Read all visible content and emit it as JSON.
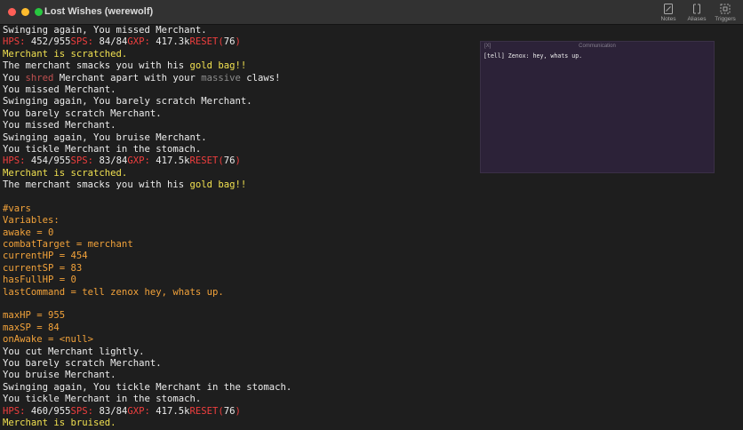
{
  "window": {
    "title": "Lost Wishes (werewolf)",
    "buttons": [
      {
        "label": "Notes",
        "icon": "notes-icon"
      },
      {
        "label": "Aliases",
        "icon": "aliases-icon"
      },
      {
        "label": "Triggers",
        "icon": "triggers-icon"
      }
    ]
  },
  "colors": {
    "default": "#ececec",
    "yellow": "#f0e050",
    "orange": "#f2a23a",
    "red": "#ef3e3e",
    "gray": "#8c8c8c",
    "comm_bg": "#2c2238"
  },
  "output": {
    "lines": [
      [
        [
          "w",
          "Swinging again, You missed Merchant."
        ]
      ],
      [
        [
          "r",
          "HPS: "
        ],
        [
          "w",
          "452/955"
        ],
        [
          "r",
          "SPS: "
        ],
        [
          "w",
          "84/84"
        ],
        [
          "r",
          "GXP: "
        ],
        [
          "w",
          "417.3k"
        ],
        [
          "r",
          "RESET("
        ],
        [
          "w",
          "76"
        ],
        [
          "r",
          ")"
        ]
      ],
      [
        [
          "y",
          "Merchant is scratched."
        ]
      ],
      [
        [
          "w",
          "The merchant smacks you with his "
        ],
        [
          "y",
          "gold bag!!"
        ]
      ],
      [
        [
          "w",
          "You "
        ],
        [
          "rd",
          "shred"
        ],
        [
          "w",
          " Merchant apart with your "
        ],
        [
          "g",
          "massive"
        ],
        [
          "w",
          " claws!"
        ]
      ],
      [
        [
          "w",
          "You missed Merchant."
        ]
      ],
      [
        [
          "w",
          "Swinging again, You barely scratch Merchant."
        ]
      ],
      [
        [
          "w",
          "You barely scratch Merchant."
        ]
      ],
      [
        [
          "w",
          "You missed Merchant."
        ]
      ],
      [
        [
          "w",
          "Swinging again, You bruise Merchant."
        ]
      ],
      [
        [
          "w",
          "You tickle Merchant in the stomach."
        ]
      ],
      [
        [
          "r",
          "HPS: "
        ],
        [
          "w",
          "454/955"
        ],
        [
          "r",
          "SPS: "
        ],
        [
          "w",
          "83/84"
        ],
        [
          "r",
          "GXP: "
        ],
        [
          "w",
          "417.5k"
        ],
        [
          "r",
          "RESET("
        ],
        [
          "w",
          "76"
        ],
        [
          "r",
          ")"
        ]
      ],
      [
        [
          "y",
          "Merchant is scratched."
        ]
      ],
      [
        [
          "w",
          "The merchant smacks you with his "
        ],
        [
          "y",
          "gold bag!!"
        ]
      ],
      [],
      [
        [
          "o",
          "#vars"
        ]
      ],
      [
        [
          "o",
          "Variables:"
        ]
      ],
      [
        [
          "o",
          "awake = 0"
        ]
      ],
      [
        [
          "o",
          "combatTarget = merchant"
        ]
      ],
      [
        [
          "o",
          "currentHP = 454"
        ]
      ],
      [
        [
          "o",
          "currentSP = 83"
        ]
      ],
      [
        [
          "o",
          "hasFullHP = 0"
        ]
      ],
      [
        [
          "o",
          "lastCommand = tell zenox hey, whats up."
        ]
      ],
      [],
      [
        [
          "o",
          "maxHP = 955"
        ]
      ],
      [
        [
          "o",
          "maxSP = 84"
        ]
      ],
      [
        [
          "o",
          "onAwake = <null>"
        ]
      ],
      [
        [
          "w",
          "You cut Merchant lightly."
        ]
      ],
      [
        [
          "w",
          "You barely scratch Merchant."
        ]
      ],
      [
        [
          "w",
          "You bruise Merchant."
        ]
      ],
      [
        [
          "w",
          "Swinging again, You tickle Merchant in the stomach."
        ]
      ],
      [
        [
          "w",
          "You tickle Merchant in the stomach."
        ]
      ],
      [
        [
          "r",
          "HPS: "
        ],
        [
          "w",
          "460/955"
        ],
        [
          "r",
          "SPS: "
        ],
        [
          "w",
          "83/84"
        ],
        [
          "r",
          "GXP: "
        ],
        [
          "w",
          "417.5k"
        ],
        [
          "r",
          "RESET("
        ],
        [
          "w",
          "76"
        ],
        [
          "r",
          ")"
        ]
      ],
      [
        [
          "y",
          "Merchant is bruised."
        ]
      ]
    ]
  },
  "communication": {
    "close_label": "[X]",
    "title": "Communication",
    "messages": [
      "[tell] Zenox: hey, whats up."
    ]
  }
}
